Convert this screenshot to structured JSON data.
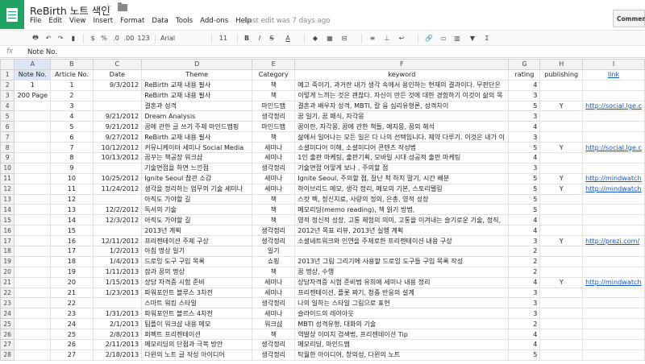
{
  "app": {
    "title": "ReBirth 노트 색인",
    "menu": [
      "File",
      "Edit",
      "View",
      "Insert",
      "Format",
      "Data",
      "Tools",
      "Add-ons",
      "Help"
    ],
    "last_edit": "Last edit was 7 days ago",
    "comments_label": "Comments"
  },
  "toolbar": {
    "zoom_pct": "%",
    "decimal": ".0",
    "decimal2": ".00",
    "more_formats": "123",
    "font": "Arial",
    "font_size": "11",
    "bold": "B",
    "italic": "I",
    "strike": "S",
    "text_color": "A",
    "sum": "Σ",
    "currency": "$",
    "dropdown": "▾"
  },
  "formula_bar": {
    "fx": "fx",
    "value": "Note No."
  },
  "grid": {
    "columns": [
      "A",
      "B",
      "C",
      "D",
      "E",
      "F",
      "G",
      "H",
      "I"
    ],
    "rows": [
      [
        "Note No.",
        "Article No.",
        "Date",
        "Theme",
        "Category",
        "keyword",
        "rating",
        "publishing",
        "link"
      ],
      [
        "1",
        "1",
        "9/3/2012",
        "ReBirth 교재 내용 필사",
        "책",
        "예고 죽이기, 과거란 내가 생각 속에서 용인하는 현재의 결과이다. 무판단은",
        "4",
        "",
        ""
      ],
      [
        "200 Page",
        "2",
        "",
        "ReBirth 교재 내용 필사",
        "책",
        "이렇게 느끼는 것은 괜찮다. 자신이 만든 것에 대한 경험하기 이것이 삶의 목",
        "3",
        "",
        ""
      ],
      [
        "",
        "3",
        "",
        "결혼과 성격",
        "마인드맵",
        "결혼과 배우자 성격, MBTI, 칼 융 심리유형론, 성격차이",
        "5",
        "Y",
        "http://social.lge.c"
      ],
      [
        "",
        "4",
        "9/21/2012",
        "Dream Analysis",
        "생각정리",
        "꿈 일기, 꿈 패식, 자각몽",
        "3",
        "",
        ""
      ],
      [
        "",
        "5",
        "9/21/2012",
        "꿈에 관한 글 쓰기 주제 마인드맵핑",
        "마인드맵",
        "꿈이란, 자각몽, 꿈에 관한 책들, 예지몽, 꿈의 해석",
        "4",
        "",
        ""
      ],
      [
        "",
        "6",
        "9/27/2012",
        "ReBirth 교재 내용 필사",
        "책",
        "삶에서 일어나는 모든 일은 다 나의 선택입니다. 제약 다루기. 이것은 내가 이",
        "3",
        "",
        ""
      ],
      [
        "",
        "7",
        "10/12/2012",
        "커뮤니케이터 세미나 Social Media",
        "세미나",
        "소셜미디어 이해, 소셜미디어 콘텐츠 작성법",
        "5",
        "Y",
        "http://social.lge.c"
      ],
      [
        "",
        "8",
        "10/13/2012",
        "꿈꾸는 책공장 워크샵",
        "세미나",
        "1인 출판 마케팅, 출판기획, 모바일 시대 성공적 출판 마케팅",
        "4",
        "",
        ""
      ],
      [
        "",
        "9",
        "",
        "기술면접을 하면 느낀점",
        "생각정리",
        "기술면접 어떻게 보나 , 주의할 점",
        "3",
        "",
        ""
      ],
      [
        "",
        "10",
        "10/25/2012",
        "Ignite Seoul 참관 소감",
        "세미나",
        "Ignite Seoul, 주의할 점, 잘난 척 하지 말기, 시간 배분",
        "5",
        "Y",
        "http://mindwatch"
      ],
      [
        "",
        "11",
        "11/24/2012",
        "생각을 정리하는 업무의 기술 세미나",
        "세미나",
        "하이브리드 메모, 생각 정리, 메모의 기본, 스토리텔링",
        "5",
        "Y",
        "http://mindwatch"
      ],
      [
        "",
        "12",
        "",
        "아직도 가야할 길",
        "책",
        "스캇 펙, 정신치료, 사랑의 정의, 은총, 영적 성장",
        "5",
        "",
        ""
      ],
      [
        "",
        "13",
        "12/2/2012",
        "독서의 기술",
        "책",
        "메모리딩(memo reading), 책 읽기 방법,",
        "5",
        "",
        ""
      ],
      [
        "",
        "14",
        "12/3/2012",
        "아직도 가야할 길",
        "책",
        "영적 정신적 성장, 고통 체험의 의미, 고통을 이겨내는 슬기로운 기술, 정직,",
        "4",
        "",
        ""
      ],
      [
        "",
        "15",
        "",
        "2013년 계획",
        "생각정리",
        "2012년 목표 리뷰, 2013년 실행 계획",
        "4",
        "",
        ""
      ],
      [
        "",
        "16",
        "12/11/2012",
        "프리젠테이션 주제 구상",
        "생각정리",
        "소셜네트워크와 인연을 주제로한 프리젠테이션 내용 구상",
        "3",
        "Y",
        "http://prezi.com/"
      ],
      [
        "",
        "17",
        "1/2/2013",
        "아침 명상 일기",
        "일기",
        "",
        "2",
        "",
        ""
      ],
      [
        "",
        "18",
        "1/4/2013",
        "드로잉 도구 구입 목록",
        "쇼핑",
        "2013년 그림 그리기에 사용할 드로잉 도구들 구입 목록 작성",
        "2",
        "",
        ""
      ],
      [
        "",
        "19",
        "1/11/2013",
        "잠과 꿈의 명상",
        "책",
        "꿈 명상, 수행",
        "2",
        "",
        ""
      ],
      [
        "",
        "20",
        "1/15/2013",
        "상담 자격증 시험 준비",
        "세미나",
        "상담자격증 시험 준비법 유희애 세미나 내용 정리",
        "4",
        "Y",
        "http://mindwatch"
      ],
      [
        "",
        "21",
        "1/23/2013",
        "파워포인트 블루스 3차전",
        "세미나",
        "프리젠테이션, 플롯 짜기, 청중 반응의 설계",
        "3",
        "",
        ""
      ],
      [
        "",
        "22",
        "",
        "스마트 워킹 스타일",
        "생각정리",
        "나의 일하는 스타일 그림으로 표현",
        "3",
        "",
        ""
      ],
      [
        "",
        "23",
        "1/31/2013",
        "파워포인트 블르스 4차전",
        "세미나",
        "슬라이드의 레이아웃",
        "3",
        "",
        ""
      ],
      [
        "",
        "24",
        "2/1/2013",
        "팀플이 워크샵 내용 메모",
        "워크샵",
        "MBTI 성격유형, 대화의 기술",
        "2",
        "",
        ""
      ],
      [
        "",
        "25",
        "2/8/2013",
        "퍼펙트 프리젠테이션",
        "책",
        "역발상 이미지 검색법, 프리젠테이션 Tip",
        "4",
        "",
        ""
      ],
      [
        "",
        "26",
        "2/11/2013",
        "메모리딩의 단점과 극복 방안",
        "생각정리",
        "메모리딩, 마인드맵",
        "4",
        "",
        ""
      ],
      [
        "",
        "27",
        "2/18/2013",
        "다윈의 노트 글 작성 아이디어",
        "생각정리",
        "탁월한 아이디어, 창의성, 다윈의 노트",
        "5",
        "",
        ""
      ]
    ]
  }
}
